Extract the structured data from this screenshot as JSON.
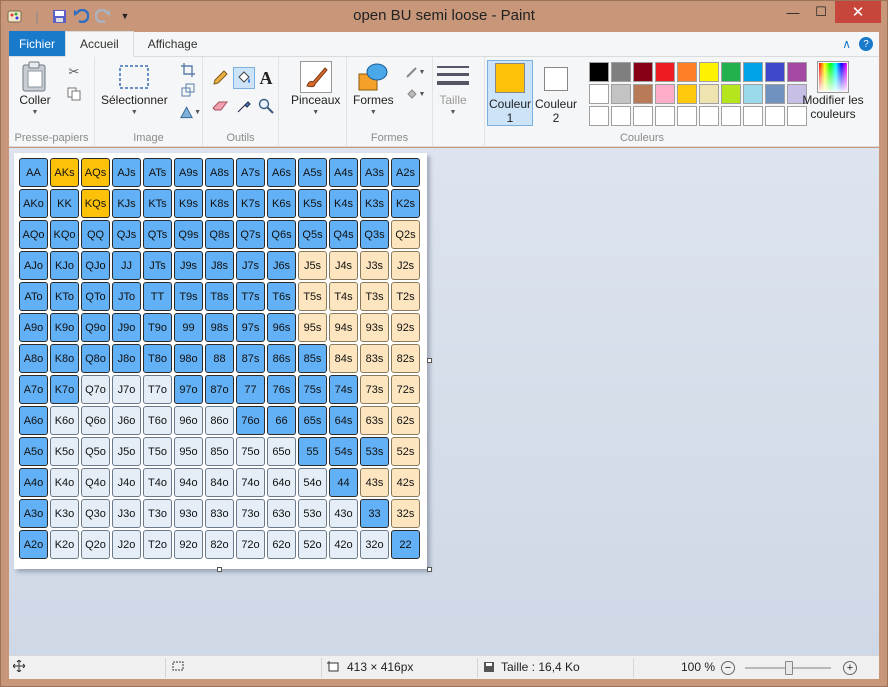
{
  "window": {
    "title": "open BU semi loose - Paint"
  },
  "tabs": {
    "file": "Fichier",
    "home": "Accueil",
    "view": "Affichage"
  },
  "ribbon": {
    "clipboard": {
      "paste": "Coller",
      "group": "Presse-papiers"
    },
    "image": {
      "select": "Sélectionner",
      "group": "Image"
    },
    "tools": {
      "group": "Outils"
    },
    "brushes": {
      "label": "Pinceaux"
    },
    "shapes": {
      "label": "Formes",
      "group": "Formes"
    },
    "size": {
      "label": "Taille"
    },
    "color1": {
      "label": "Couleur",
      "num": "1",
      "value": "#fdc10a"
    },
    "color2": {
      "label": "Couleur",
      "num": "2",
      "value": "#ffffff"
    },
    "colors_group": "Couleurs",
    "edit_colors": {
      "line1": "Modifier les",
      "line2": "couleurs"
    },
    "palette_row1": [
      "#000000",
      "#7f7f7f",
      "#880015",
      "#ed1c24",
      "#ff7f27",
      "#fff200",
      "#22b14c",
      "#00a2e8",
      "#3f48cc",
      "#a349a4"
    ],
    "palette_row2": [
      "#ffffff",
      "#c3c3c3",
      "#b97a57",
      "#ffaec9",
      "#ffc90e",
      "#efe4b0",
      "#b5e61d",
      "#99d9ea",
      "#7092be",
      "#c8bfe7"
    ],
    "palette_row3": [
      "#ffffff",
      "#ffffff",
      "#ffffff",
      "#ffffff",
      "#ffffff",
      "#ffffff",
      "#ffffff",
      "#ffffff",
      "#ffffff",
      "#ffffff"
    ]
  },
  "range_grid": {
    "color_codes": {
      "b": "#62b0f5",
      "y": "#fdc10a",
      "l": "#fce5bf",
      "w": "#e5eef7"
    },
    "rows": [
      [
        [
          "AA",
          "b"
        ],
        [
          "AKs",
          "y"
        ],
        [
          "AQs",
          "y"
        ],
        [
          "AJs",
          "b"
        ],
        [
          "ATs",
          "b"
        ],
        [
          "A9s",
          "b"
        ],
        [
          "A8s",
          "b"
        ],
        [
          "A7s",
          "b"
        ],
        [
          "A6s",
          "b"
        ],
        [
          "A5s",
          "b"
        ],
        [
          "A4s",
          "b"
        ],
        [
          "A3s",
          "b"
        ],
        [
          "A2s",
          "b"
        ]
      ],
      [
        [
          "AKo",
          "b"
        ],
        [
          "KK",
          "b"
        ],
        [
          "KQs",
          "y"
        ],
        [
          "KJs",
          "b"
        ],
        [
          "KTs",
          "b"
        ],
        [
          "K9s",
          "b"
        ],
        [
          "K8s",
          "b"
        ],
        [
          "K7s",
          "b"
        ],
        [
          "K6s",
          "b"
        ],
        [
          "K5s",
          "b"
        ],
        [
          "K4s",
          "b"
        ],
        [
          "K3s",
          "b"
        ],
        [
          "K2s",
          "b"
        ]
      ],
      [
        [
          "AQo",
          "b"
        ],
        [
          "KQo",
          "b"
        ],
        [
          "QQ",
          "b"
        ],
        [
          "QJs",
          "b"
        ],
        [
          "QTs",
          "b"
        ],
        [
          "Q9s",
          "b"
        ],
        [
          "Q8s",
          "b"
        ],
        [
          "Q7s",
          "b"
        ],
        [
          "Q6s",
          "b"
        ],
        [
          "Q5s",
          "b"
        ],
        [
          "Q4s",
          "b"
        ],
        [
          "Q3s",
          "b"
        ],
        [
          "Q2s",
          "l"
        ]
      ],
      [
        [
          "AJo",
          "b"
        ],
        [
          "KJo",
          "b"
        ],
        [
          "QJo",
          "b"
        ],
        [
          "JJ",
          "b"
        ],
        [
          "JTs",
          "b"
        ],
        [
          "J9s",
          "b"
        ],
        [
          "J8s",
          "b"
        ],
        [
          "J7s",
          "b"
        ],
        [
          "J6s",
          "b"
        ],
        [
          "J5s",
          "l"
        ],
        [
          "J4s",
          "l"
        ],
        [
          "J3s",
          "l"
        ],
        [
          "J2s",
          "l"
        ]
      ],
      [
        [
          "ATo",
          "b"
        ],
        [
          "KTo",
          "b"
        ],
        [
          "QTo",
          "b"
        ],
        [
          "JTo",
          "b"
        ],
        [
          "TT",
          "b"
        ],
        [
          "T9s",
          "b"
        ],
        [
          "T8s",
          "b"
        ],
        [
          "T7s",
          "b"
        ],
        [
          "T6s",
          "b"
        ],
        [
          "T5s",
          "l"
        ],
        [
          "T4s",
          "l"
        ],
        [
          "T3s",
          "l"
        ],
        [
          "T2s",
          "l"
        ]
      ],
      [
        [
          "A9o",
          "b"
        ],
        [
          "K9o",
          "b"
        ],
        [
          "Q9o",
          "b"
        ],
        [
          "J9o",
          "b"
        ],
        [
          "T9o",
          "b"
        ],
        [
          "99",
          "b"
        ],
        [
          "98s",
          "b"
        ],
        [
          "97s",
          "b"
        ],
        [
          "96s",
          "b"
        ],
        [
          "95s",
          "l"
        ],
        [
          "94s",
          "l"
        ],
        [
          "93s",
          "l"
        ],
        [
          "92s",
          "l"
        ]
      ],
      [
        [
          "A8o",
          "b"
        ],
        [
          "K8o",
          "b"
        ],
        [
          "Q8o",
          "b"
        ],
        [
          "J8o",
          "b"
        ],
        [
          "T8o",
          "b"
        ],
        [
          "98o",
          "b"
        ],
        [
          "88",
          "b"
        ],
        [
          "87s",
          "b"
        ],
        [
          "86s",
          "b"
        ],
        [
          "85s",
          "b"
        ],
        [
          "84s",
          "l"
        ],
        [
          "83s",
          "l"
        ],
        [
          "82s",
          "l"
        ]
      ],
      [
        [
          "A7o",
          "b"
        ],
        [
          "K7o",
          "b"
        ],
        [
          "Q7o",
          "w"
        ],
        [
          "J7o",
          "w"
        ],
        [
          "T7o",
          "w"
        ],
        [
          "97o",
          "b"
        ],
        [
          "87o",
          "b"
        ],
        [
          "77",
          "b"
        ],
        [
          "76s",
          "b"
        ],
        [
          "75s",
          "b"
        ],
        [
          "74s",
          "b"
        ],
        [
          "73s",
          "l"
        ],
        [
          "72s",
          "l"
        ]
      ],
      [
        [
          "A6o",
          "b"
        ],
        [
          "K6o",
          "w"
        ],
        [
          "Q6o",
          "w"
        ],
        [
          "J6o",
          "w"
        ],
        [
          "T6o",
          "w"
        ],
        [
          "96o",
          "w"
        ],
        [
          "86o",
          "w"
        ],
        [
          "76o",
          "b"
        ],
        [
          "66",
          "b"
        ],
        [
          "65s",
          "b"
        ],
        [
          "64s",
          "b"
        ],
        [
          "63s",
          "l"
        ],
        [
          "62s",
          "l"
        ]
      ],
      [
        [
          "A5o",
          "b"
        ],
        [
          "K5o",
          "w"
        ],
        [
          "Q5o",
          "w"
        ],
        [
          "J5o",
          "w"
        ],
        [
          "T5o",
          "w"
        ],
        [
          "95o",
          "w"
        ],
        [
          "85o",
          "w"
        ],
        [
          "75o",
          "w"
        ],
        [
          "65o",
          "w"
        ],
        [
          "55",
          "b"
        ],
        [
          "54s",
          "b"
        ],
        [
          "53s",
          "b"
        ],
        [
          "52s",
          "l"
        ]
      ],
      [
        [
          "A4o",
          "b"
        ],
        [
          "K4o",
          "w"
        ],
        [
          "Q4o",
          "w"
        ],
        [
          "J4o",
          "w"
        ],
        [
          "T4o",
          "w"
        ],
        [
          "94o",
          "w"
        ],
        [
          "84o",
          "w"
        ],
        [
          "74o",
          "w"
        ],
        [
          "64o",
          "w"
        ],
        [
          "54o",
          "w"
        ],
        [
          "44",
          "b"
        ],
        [
          "43s",
          "l"
        ],
        [
          "42s",
          "l"
        ]
      ],
      [
        [
          "A3o",
          "b"
        ],
        [
          "K3o",
          "w"
        ],
        [
          "Q3o",
          "w"
        ],
        [
          "J3o",
          "w"
        ],
        [
          "T3o",
          "w"
        ],
        [
          "93o",
          "w"
        ],
        [
          "83o",
          "w"
        ],
        [
          "73o",
          "w"
        ],
        [
          "63o",
          "w"
        ],
        [
          "53o",
          "w"
        ],
        [
          "43o",
          "w"
        ],
        [
          "33",
          "b"
        ],
        [
          "32s",
          "l"
        ]
      ],
      [
        [
          "A2o",
          "b"
        ],
        [
          "K2o",
          "w"
        ],
        [
          "Q2o",
          "w"
        ],
        [
          "J2o",
          "w"
        ],
        [
          "T2o",
          "w"
        ],
        [
          "92o",
          "w"
        ],
        [
          "82o",
          "w"
        ],
        [
          "72o",
          "w"
        ],
        [
          "62o",
          "w"
        ],
        [
          "52o",
          "w"
        ],
        [
          "42o",
          "w"
        ],
        [
          "32o",
          "w"
        ],
        [
          "22",
          "b"
        ]
      ]
    ]
  },
  "status": {
    "dimensions": "413 × 416px",
    "size": "Taille : 16,4 Ko",
    "zoom": "100 %"
  }
}
